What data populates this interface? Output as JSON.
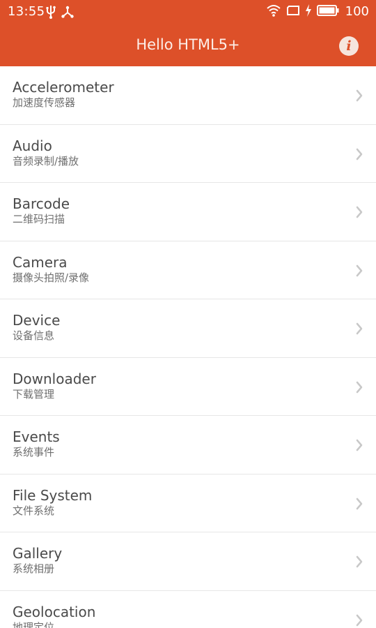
{
  "status_bar": {
    "time": "13:55",
    "battery_level": "100",
    "icons": [
      "usb-icon",
      "share-icon",
      "wifi-icon",
      "screen-icon",
      "charging-icon",
      "battery-icon"
    ]
  },
  "app_bar": {
    "title": "Hello HTML5+",
    "info_icon": "info-icon"
  },
  "colors": {
    "accent": "#dd5029",
    "divider": "#e6e6e6",
    "title_text": "#4a4a4a",
    "subtitle_text": "#6f6f6f",
    "chevron": "#c8c8c8"
  },
  "list": {
    "items": [
      {
        "title": "Accelerometer",
        "subtitle": "加速度传感器"
      },
      {
        "title": "Audio",
        "subtitle": "音频录制/播放"
      },
      {
        "title": "Barcode",
        "subtitle": "二维码扫描"
      },
      {
        "title": "Camera",
        "subtitle": "摄像头拍照/录像"
      },
      {
        "title": "Device",
        "subtitle": "设备信息"
      },
      {
        "title": "Downloader",
        "subtitle": "下载管理"
      },
      {
        "title": "Events",
        "subtitle": "系统事件"
      },
      {
        "title": "File System",
        "subtitle": "文件系统"
      },
      {
        "title": "Gallery",
        "subtitle": "系统相册"
      },
      {
        "title": "Geolocation",
        "subtitle": "地理定位"
      }
    ]
  }
}
